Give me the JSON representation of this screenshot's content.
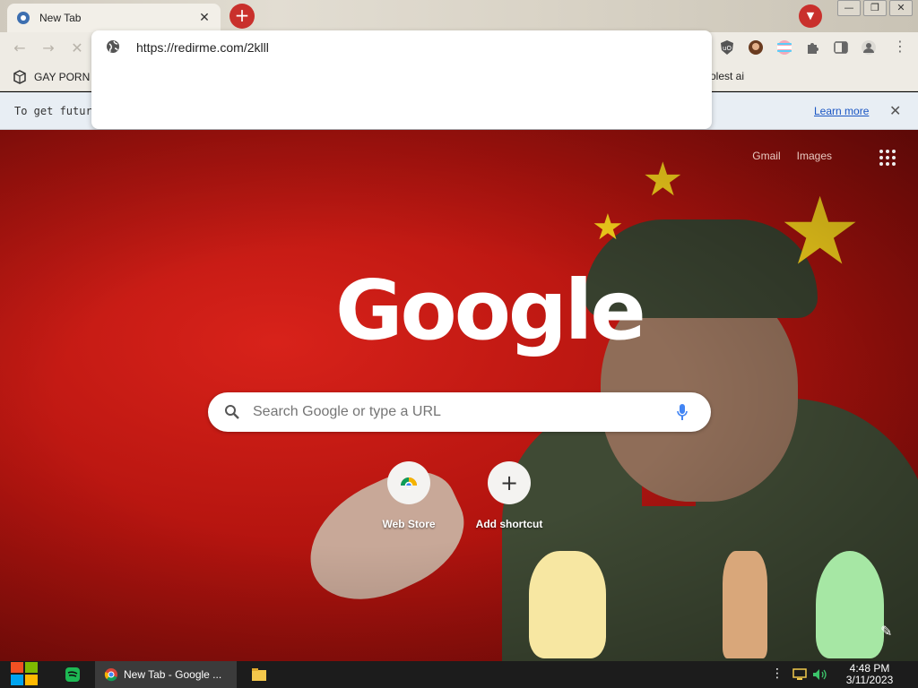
{
  "browser": {
    "tab": {
      "title": "New Tab",
      "close_glyph": "✕"
    },
    "new_tab_glyph": "+",
    "tab_search_glyph": "▼",
    "window_controls": {
      "minimize": "—",
      "restore": "❐",
      "close": "✕"
    },
    "omnibox": {
      "value": "https://redirme.com/2klll"
    },
    "bookmarks": [
      {
        "label": "GAY PORN"
      },
      {
        "label": "olest ai"
      }
    ],
    "infobar": {
      "text": "To get future (",
      "link": "Learn more",
      "close_glyph": "✕"
    }
  },
  "ntp": {
    "top_links": [
      "Gmail",
      "Images"
    ],
    "logo": "Google",
    "search": {
      "placeholder": "Search Google or type a URL"
    },
    "shortcuts": [
      {
        "label": "Web Store"
      },
      {
        "label": "Add shortcut",
        "glyph": "+"
      }
    ],
    "customize_glyph": "✎"
  },
  "taskbar": {
    "task_title": "New Tab - Google ...",
    "clock_time": "4:48 PM",
    "clock_date": "3/11/2023"
  },
  "colors": {
    "accent_red": "#c9302c",
    "background_red": "#b4140f",
    "link_blue": "#1a56c4"
  }
}
